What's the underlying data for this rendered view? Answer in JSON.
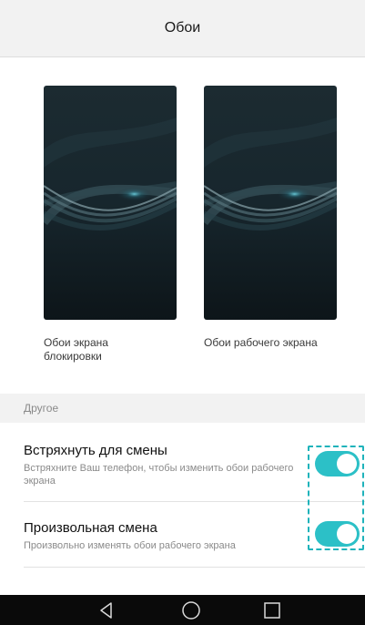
{
  "header": {
    "title": "Обои"
  },
  "wallpapers": [
    {
      "label": "Обои экрана блокировки"
    },
    {
      "label": "Обои рабочего экрана"
    }
  ],
  "section": {
    "title": "Другое"
  },
  "settings": [
    {
      "title": "Встряхнуть для смены",
      "subtitle": "Встряхните Ваш телефон, чтобы изменить обои рабочего экрана",
      "enabled": true
    },
    {
      "title": "Произвольная смена",
      "subtitle": "Произвольно изменять обои рабочего экрана",
      "enabled": true
    }
  ],
  "navbar": {
    "icons": [
      "back-icon",
      "home-icon",
      "recents-icon"
    ]
  },
  "colors": {
    "accent": "#2cc0c7",
    "header_bg": "#f2f2f2",
    "navbar_bg": "#0a0a0a"
  }
}
